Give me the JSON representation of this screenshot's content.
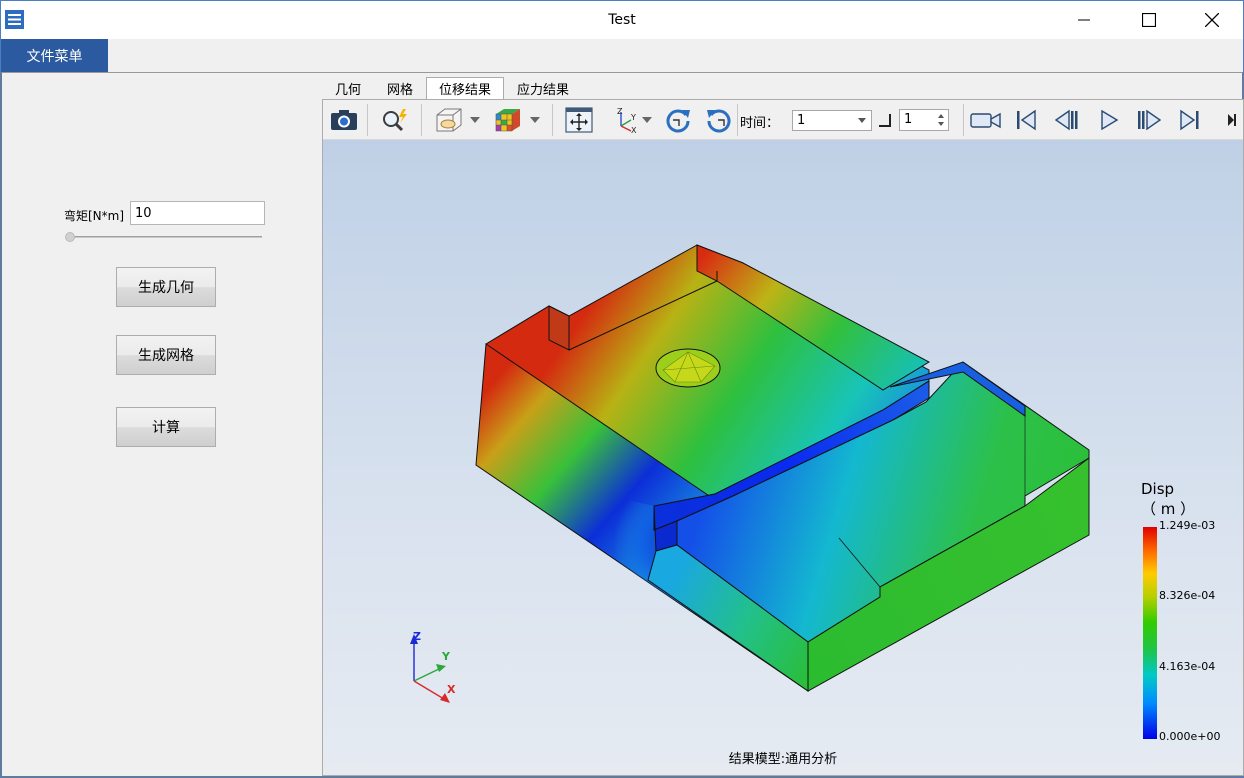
{
  "window": {
    "title": "Test"
  },
  "menu": {
    "file": "文件菜单"
  },
  "left_panel": {
    "moment_label": "弯矩[N*m]",
    "moment_value": "10",
    "buttons": {
      "geometry": "生成几何",
      "mesh": "生成网格",
      "compute": "计算"
    }
  },
  "tabs": [
    {
      "label": "几何",
      "active": false
    },
    {
      "label": "网格",
      "active": false
    },
    {
      "label": "位移结果",
      "active": true
    },
    {
      "label": "应力结果",
      "active": false
    }
  ],
  "toolbar": {
    "time_label": "时间：",
    "time_value": "1",
    "step_value": "1",
    "icons": [
      "camera-icon",
      "zoom-icon",
      "display-mode-icon",
      "color-cube-icon",
      "fit-view-icon",
      "axes-icon",
      "rotate-ccw-icon",
      "rotate-cw-icon",
      "record-icon",
      "first-frame-icon",
      "prev-frame-icon",
      "play-icon",
      "next-frame-icon",
      "last-frame-icon"
    ]
  },
  "viewport": {
    "model_label": "结果模型:通用分析",
    "axes": {
      "x": "X",
      "y": "Y",
      "z": "Z"
    },
    "legend": {
      "title": "Disp",
      "unit": "（ m ）",
      "values": [
        "1.249e-03",
        "8.326e-04",
        "4.163e-04",
        "0.000e+00"
      ]
    }
  },
  "colors": {
    "menu_bg": "#2c5aa0",
    "window_border": "#4a7fc1"
  }
}
